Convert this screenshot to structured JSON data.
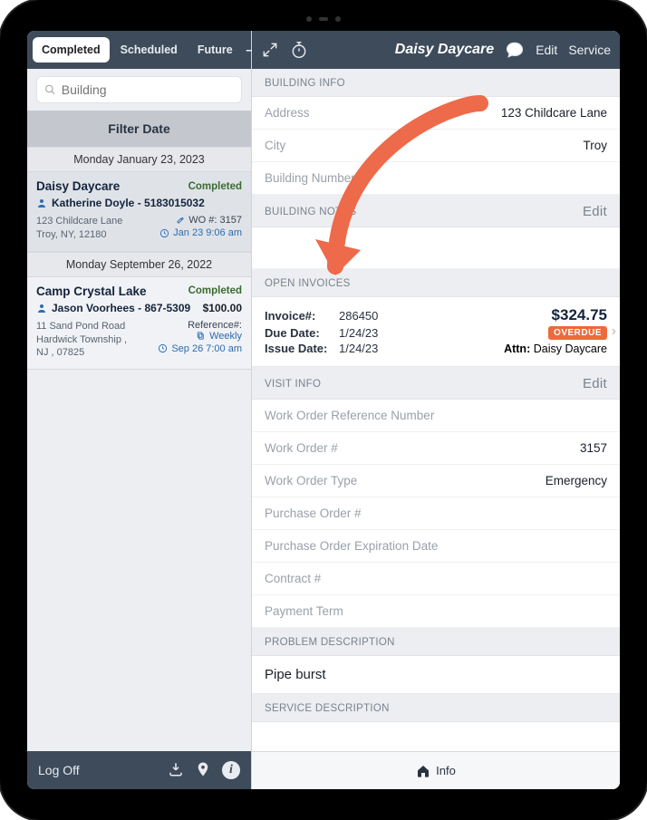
{
  "left": {
    "tabs": {
      "completed": "Completed",
      "scheduled": "Scheduled",
      "future": "Future"
    },
    "search_placeholder": "Building",
    "filter_label": "Filter Date",
    "groups": [
      {
        "date": "Monday January 23, 2023",
        "items": [
          {
            "name": "Daisy Daycare",
            "status": "Completed",
            "person": "Katherine Doyle - 5183015032",
            "addr1": "123 Childcare Lane",
            "addr2": "Troy, NY, 12180",
            "wo": "WO #: 3157",
            "time": "Jan 23 9:06 am"
          }
        ]
      },
      {
        "date": "Monday September 26, 2022",
        "items": [
          {
            "name": "Camp Crystal Lake",
            "status": "Completed",
            "person": "Jason Voorhees - 867-5309",
            "amount": "$100.00",
            "addr1": "11 Sand Pond Road",
            "addr2": "Hardwick Township ,",
            "addr3": "NJ , 07825",
            "ref_label": "Reference#:",
            "recur": "Weekly",
            "time": "Sep 26 7:00 am"
          }
        ]
      }
    ],
    "logoff": "Log Off"
  },
  "right": {
    "title": "Daisy Daycare",
    "edit": "Edit",
    "service": "Service",
    "sections": {
      "building_info": "BUILDING INFO",
      "building_notes": "BUILDING NOTES",
      "open_invoices": "OPEN INVOICES",
      "visit_info": "VISIT INFO",
      "problem_desc": "PROBLEM DESCRIPTION",
      "service_desc": "SERVICE DESCRIPTION"
    },
    "building": {
      "address_label": "Address",
      "address": "123 Childcare Lane",
      "city_label": "City",
      "city": "Troy",
      "bnum_label": "Building Number"
    },
    "notes_edit": "Edit",
    "invoice": {
      "num_label": "Invoice#:",
      "num": "286450",
      "amount": "$324.75",
      "due_label": "Due Date:",
      "due": "1/24/23",
      "overdue": "OVERDUE",
      "issue_label": "Issue Date:",
      "issue": "1/24/23",
      "attn_label": "Attn:",
      "attn": "Daisy Daycare"
    },
    "visit_edit": "Edit",
    "visit": {
      "woref": "Work Order Reference Number",
      "wonum_label": "Work Order #",
      "wonum": "3157",
      "wotype_label": "Work Order Type",
      "wotype": "Emergency",
      "po": "Purchase Order #",
      "poexp": "Purchase Order Expiration Date",
      "contract": "Contract #",
      "payterm": "Payment Term"
    },
    "problem_text": "Pipe burst",
    "info_tab": "Info"
  },
  "colors": {
    "accent_arrow": "#ed6a4a"
  }
}
